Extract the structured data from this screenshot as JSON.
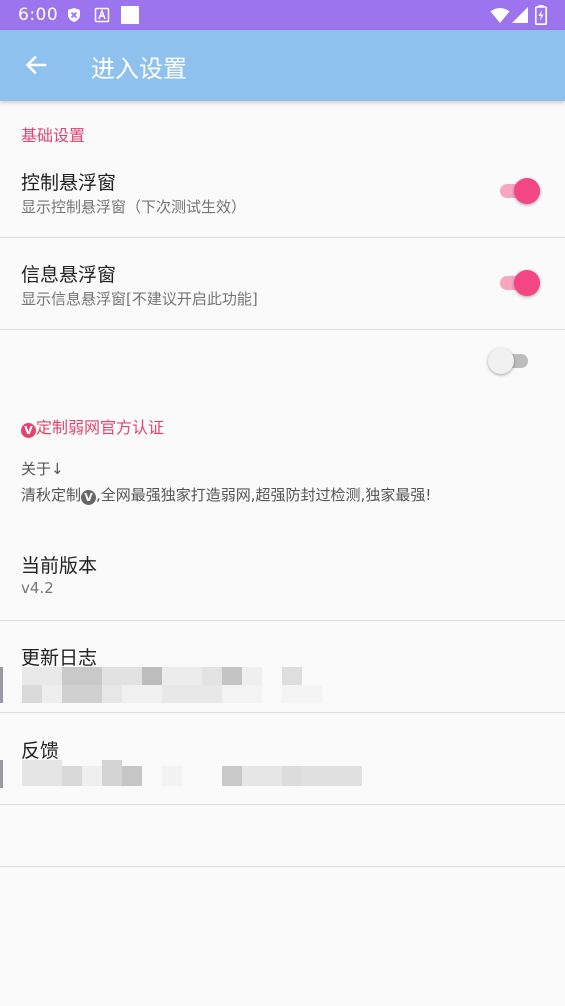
{
  "status_bar": {
    "time": "6:00",
    "icons": [
      "shield-icon",
      "a-icon",
      "square-icon",
      "wifi-icon",
      "signal-icon",
      "battery-icon"
    ]
  },
  "app_bar": {
    "back_icon": "arrow-left-icon",
    "title": "进入设置"
  },
  "colors": {
    "status_bar": "#9b74ee",
    "app_bar": "#8fc1ee",
    "accent": "#f44683",
    "category_text": "#e2446f"
  },
  "basic_settings": {
    "header": "基础设置",
    "items": [
      {
        "title": "控制悬浮窗",
        "summary": "显示控制悬浮窗（下次测试生效）",
        "enabled": true
      },
      {
        "title": "信息悬浮窗",
        "summary": "显示信息悬浮窗[不建议开启此功能]",
        "enabled": true
      }
    ],
    "extra_switch_enabled": false
  },
  "about": {
    "header_badge": "V",
    "header": "定制弱网官方认证",
    "about_title": "关于↓",
    "about_text_a": "清秋定制",
    "about_badge": "V",
    "about_text_b": ",全网最强独家打造弱网,超强防封过检测,独家最强!",
    "version_title": "当前版本",
    "version_value": "v4.2",
    "changelog_title": "更新日志",
    "feedback_title": "反馈"
  }
}
